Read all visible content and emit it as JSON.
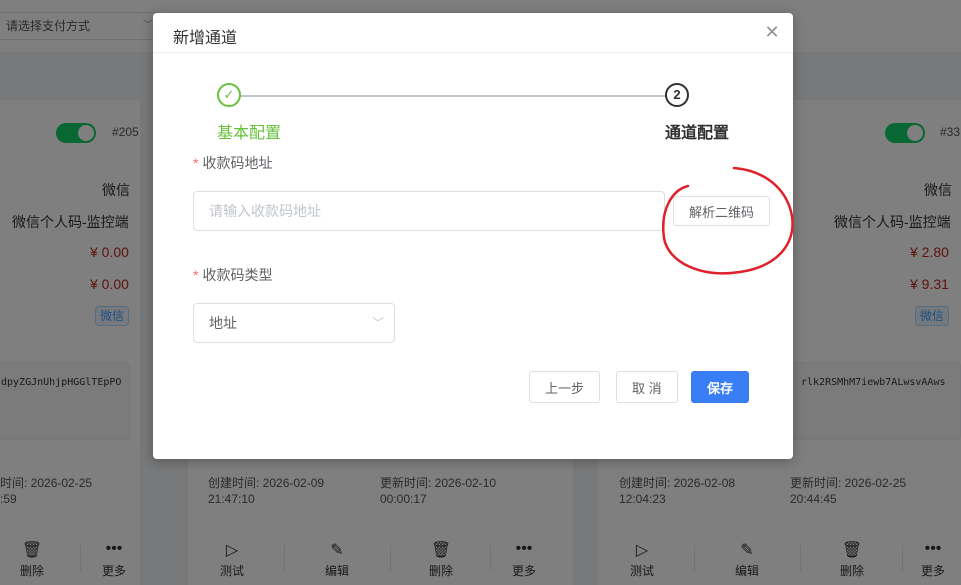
{
  "background": {
    "pay_select_placeholder": "请选择支付方式",
    "cards": [
      {
        "id": "#205",
        "platform": "微信",
        "name": "微信个人码-监控端",
        "amount1": "¥ 0.00",
        "amount2": "¥ 0.00",
        "tag": "微信",
        "key": "dpyZGJnUhjpHGGlTEpPO",
        "time1_label": "时间: 2026-02-25",
        "time1_time": ":59"
      },
      {
        "created_label": "创建时间: 2026-02-09",
        "created_time": "21:47:10",
        "updated_label": "更新时间: 2026-02-10",
        "updated_time": "00:00:17"
      },
      {
        "id": "#33",
        "platform": "微信",
        "name": "微信个人码-监控端",
        "amount1": "¥ 2.80",
        "amount2": "¥ 9.31",
        "tag": "微信",
        "key": "rlk2RSMhM7iewb7ALwsvAAws",
        "created_label": "创建时间: 2026-02-08",
        "created_time": "12:04:23",
        "updated_label": "更新时间: 2026-02-25",
        "updated_time": "20:44:45"
      }
    ],
    "actions": {
      "delete": "删除",
      "more": "更多",
      "test": "测试",
      "edit": "编辑"
    }
  },
  "dialog": {
    "title": "新增通道",
    "steps": [
      {
        "title": "基本配置",
        "status": "done"
      },
      {
        "number": "2",
        "title": "通道配置",
        "status": "current"
      }
    ],
    "qr_url": {
      "label": "收款码地址",
      "placeholder": "请输入收款码地址",
      "value": "",
      "parse_button": "解析二维码"
    },
    "qr_type": {
      "label": "收款码类型",
      "selected": "地址"
    },
    "buttons": {
      "prev": "上一步",
      "cancel": "取 消",
      "save": "保存"
    }
  },
  "colors": {
    "accent": "#3a7ef6",
    "success": "#67c23a",
    "required": "#f56c6c",
    "price": "#c0261b",
    "toggle_on": "#13ce66",
    "annotation": "#e0202a"
  }
}
